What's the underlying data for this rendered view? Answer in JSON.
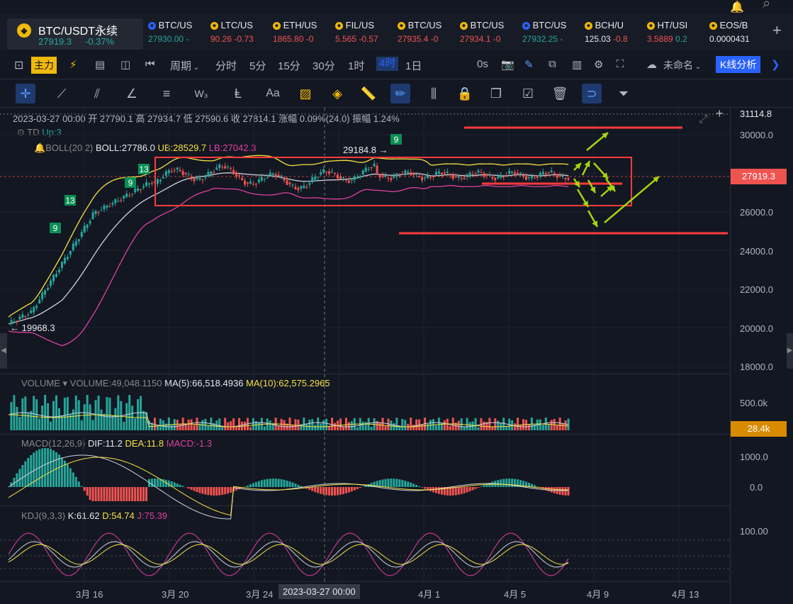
{
  "main_symbol": {
    "name": "BTC/USDT永续",
    "price": "27919.3",
    "change": "-0.37%"
  },
  "tickers": [
    {
      "name": "BTC/US",
      "price": "27930.00",
      "change": "-",
      "pc": "green",
      "cc": "green"
    },
    {
      "name": "LTC/US",
      "price": "90.26",
      "change": "-0.73",
      "pc": "red",
      "cc": "red"
    },
    {
      "name": "ETH/US",
      "price": "1865.80",
      "change": "-0",
      "pc": "red",
      "cc": "red"
    },
    {
      "name": "FIL/US",
      "price": "5.565",
      "change": "-0.57",
      "pc": "red",
      "cc": "red"
    },
    {
      "name": "BTC/US",
      "price": "27935.4",
      "change": "-0",
      "pc": "red",
      "cc": "red"
    },
    {
      "name": "BTC/US",
      "price": "27934.1",
      "change": "-0",
      "pc": "red",
      "cc": "red"
    },
    {
      "name": "BTC/US",
      "price": "27932.25",
      "change": "-",
      "pc": "green",
      "cc": "green"
    },
    {
      "name": "BCH/U",
      "price": "125.03",
      "change": "-0.8",
      "pc": "white",
      "cc": "red"
    },
    {
      "name": "HT/USI",
      "price": "3.5889",
      "change": "0.2",
      "pc": "red",
      "cc": "green"
    },
    {
      "name": "EOS/B",
      "price": "0.0000431",
      "change": "",
      "pc": "white",
      "cc": "white"
    }
  ],
  "toolbar": {
    "main": "主力",
    "period": "周期",
    "intervals": [
      "分时",
      "5分",
      "15分",
      "30分",
      "1时",
      "4时",
      "1日"
    ],
    "active_interval": "4时",
    "zero_s": "0s",
    "layout_name": "未命名",
    "analysis": "K线分析"
  },
  "ohlc": "2023-03-27 00:00  开 27790.1  高 27934.7  低 27590.6  收 27814.1  涨幅 0.09%(24.0)  振幅 1.24%",
  "td": {
    "label": "TD",
    "value": "Up:3"
  },
  "boll": {
    "label": "BOLL(20,2)",
    "boll": "BOLL:27786.0",
    "ub": "UB:28529.7",
    "lb": "LB:27042.3"
  },
  "annotations": {
    "high": "29184.8 →",
    "low": "← 19968.3",
    "td_marks": [
      "9",
      "13",
      "9",
      "13",
      "9"
    ]
  },
  "price_axis": [
    "31114.8",
    "30000.0",
    "28000.0",
    "26000.0",
    "24000.0",
    "22000.0",
    "20000.0",
    "18000.0"
  ],
  "current_price": "27919.3",
  "volume": {
    "label": "VOLUME",
    "vol": "VOLUME:49,048.1150",
    "ma5": "MA(5):66,518.4936",
    "ma10": "MA(10):62,575.2965",
    "axis": "500.0k",
    "tag": "28.4k"
  },
  "macd": {
    "label": "MACD(12,26,9)",
    "dif": "DIF:11.2",
    "dea": "DEA:11.8",
    "macd": "MACD:-1.3",
    "axis": [
      "1000.0",
      "0.0"
    ]
  },
  "kdj": {
    "label": "KDJ(9,3,3)",
    "k": "K:61.62",
    "d": "D:54.74",
    "j": "J:75.39",
    "axis": "100.00"
  },
  "x_axis": [
    "3月 16",
    "3月 20",
    "3月 24",
    "2023-03-27 00:00",
    "4月 1",
    "4月 5",
    "4月 9",
    "4月 13"
  ],
  "colors": {
    "bg": "#131722",
    "up": "#26a69a",
    "down": "#ef5350",
    "boll_mid": "#cfd3dc",
    "ub": "#f5e142",
    "lb": "#e040a0",
    "annot": "#ff3b3b",
    "arrow": "#a5d610"
  }
}
